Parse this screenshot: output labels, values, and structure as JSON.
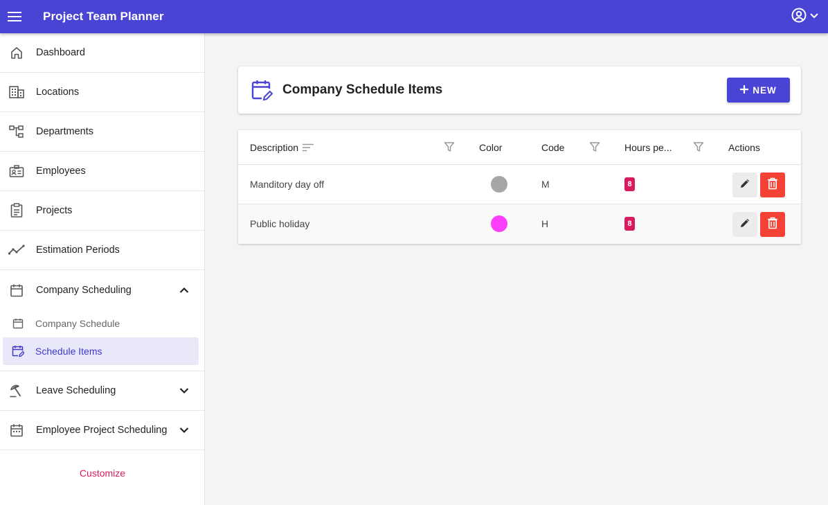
{
  "app": {
    "title": "Project Team Planner"
  },
  "colors": {
    "primary": "#4a44d4",
    "accent": "#d81b60",
    "danger": "#f44336"
  },
  "sidebar": {
    "items": [
      {
        "label": "Dashboard",
        "icon": "home-icon"
      },
      {
        "label": "Locations",
        "icon": "building-icon"
      },
      {
        "label": "Departments",
        "icon": "hierarchy-icon"
      },
      {
        "label": "Employees",
        "icon": "id-card-icon"
      },
      {
        "label": "Projects",
        "icon": "clipboard-icon"
      },
      {
        "label": "Estimation Periods",
        "icon": "trend-line-icon"
      },
      {
        "label": "Company Scheduling",
        "icon": "calendar-icon",
        "expanded": true
      },
      {
        "label": "Leave Scheduling",
        "icon": "beach-umbrella-icon",
        "expanded": false
      },
      {
        "label": "Employee Project Scheduling",
        "icon": "calendar-dots-icon",
        "expanded": false
      }
    ],
    "subitems": [
      {
        "label": "Company Schedule",
        "icon": "calendar-icon",
        "active": false
      },
      {
        "label": "Schedule Items",
        "icon": "calendar-edit-icon",
        "active": true
      }
    ],
    "customize": "Customize"
  },
  "header": {
    "title": "Company Schedule Items",
    "new_button": "NEW"
  },
  "table": {
    "columns": [
      "Description",
      "Color",
      "Code",
      "Hours pe...",
      "Actions"
    ],
    "rows": [
      {
        "description": "Manditory day off",
        "color": "#a6a6a6",
        "code": "M",
        "hours": "8"
      },
      {
        "description": "Public holiday",
        "color": "#fb3ffb",
        "code": "H",
        "hours": "8"
      }
    ]
  }
}
